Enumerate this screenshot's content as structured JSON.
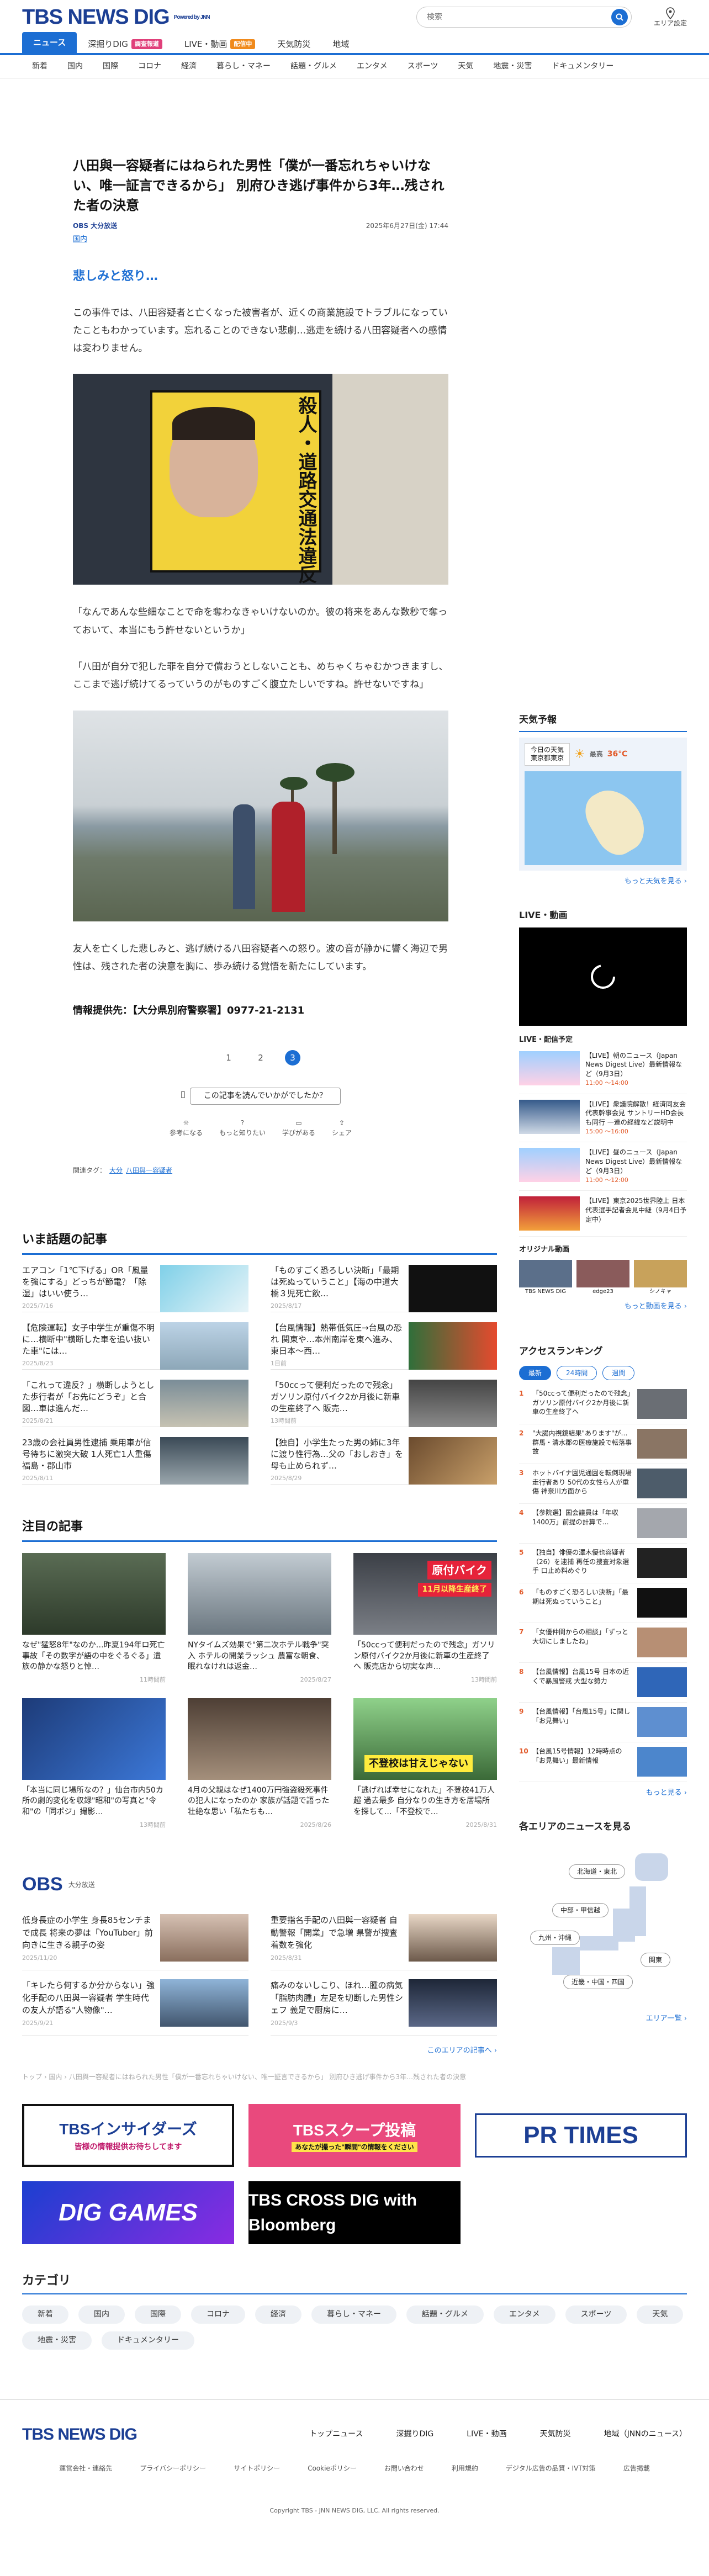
{
  "header": {
    "logo_text": "TBS NEWS DIG",
    "powered": "Powered by JNN",
    "search_placeholder": "検索",
    "area_label": "エリア設定"
  },
  "nav_primary": [
    {
      "label": "ニュース",
      "active": true
    },
    {
      "label": "深掘りDIG",
      "badge": "調査報道"
    },
    {
      "label": "LIVE・動画",
      "badge": "配信中"
    },
    {
      "label": "天気防災"
    },
    {
      "label": "地域"
    }
  ],
  "nav_secondary": [
    "新着",
    "国内",
    "国際",
    "コロナ",
    "経済",
    "暮らし・マネー",
    "話題・グルメ",
    "エンタメ",
    "スポーツ",
    "天気",
    "地震・災害",
    "ドキュメンタリー"
  ],
  "article": {
    "title": "八田與一容疑者にはねられた男性「僕が一番忘れちゃいけない、唯一証言できるから」 別府ひき逃げ事件から3年…残された者の決意",
    "source": "OBS 大分放送",
    "category": "国内",
    "date": "2025年6月27日(金) 17:44",
    "subheading": "悲しみと怒り…",
    "para1": "この事件では、八田容疑者と亡くなった被害者が、近くの商業施設でトラブルになっていたこともわかっています。忘れることのできない悲劇…逃走を続ける八田容疑者への感情は変わりません。",
    "para2": "「なんであんな些細なことで命を奪わなきゃいけないのか。彼の将来をあんな数秒で奪っておいて、本当にもう許せないというか」",
    "para3": "「八田が自分で犯した罪を自分で償おうとしないことも、めちゃくちゃむかつきますし、ここまで逃げ続けてるっていうのがものすごく腹立たしいですね。許せないですね」",
    "para4": "友人を亡くした悲しみと、逃げ続ける八田容疑者への怒り。波の音が静かに響く海辺で男性は、残された者の決意を胸に、歩み続ける覚悟を新たにしています。",
    "poster_text": "殺人・道路交通法違反",
    "credit": "情報提供先：【大分県別府警察署】0977-21-2131",
    "pages": [
      "1",
      "2",
      "3"
    ],
    "feedback_q": "この記事を読んでいかがでしたか？",
    "reactions": [
      "参考になる",
      "もっと知りたい",
      "学びがある",
      "シェア"
    ],
    "tags_label": "関連タグ：",
    "tags": [
      "大分",
      "八田與一容疑者"
    ]
  },
  "hot": {
    "title": "いま話題の記事",
    "items": [
      {
        "text": "エアコン「1℃下げる」OR「風量を強にする」どっちが節電？「除湿」はいい使う…",
        "date": "2025/7/16"
      },
      {
        "text": "「ものすごく恐ろしい決断」「最期は死ぬっていうこと」【海の中道大橋３児死亡飲…",
        "date": "2025/8/17"
      },
      {
        "text": "【危険運転】女子中学生が重傷不明に…横断中\"横断した車を追い抜いた車\"には…",
        "date": "2025/8/23"
      },
      {
        "text": "【台風情報】熱帯低気圧→台風の恐れ 関東や…本州南岸を東へ進み、東日本〜西…",
        "date": "1日前"
      },
      {
        "text": "「これって違反？」横断しようとした歩行者が「お先にどうぞ」と合図…車は進んだ…",
        "date": "2025/8/21"
      },
      {
        "text": "「50ccって便利だったので残念」ガソリン原付バイク2か月後に新車の生産終了へ 販売…",
        "date": "13時間前"
      },
      {
        "text": "23歳の会社員男性逮捕 乗用車が信号待ちに激突大破 1人死亡1人重傷 福島・郡山市",
        "date": "2025/8/11"
      },
      {
        "text": "【独自】小学生たった男の姉に3年に渡り性行為…父の「おしおき」を母も止められず…",
        "date": "2025/8/29"
      }
    ]
  },
  "featured": {
    "title": "注目の記事",
    "items": [
      {
        "text": "なぜ\"猛怒8年\"なのか…昨夏194年ロ死亡事故「その数字が語の中をぐるぐる」遺族の静かな怒りと悼…",
        "date": "11時間前"
      },
      {
        "text": "NYタイムズ効果で\"第二次ホテル戦争\"突入 ホテルの開業ラッシュ 農富な朝食、眠れなけれは返金…",
        "date": "2025/8/27"
      },
      {
        "text": "「50ccって便利だったので残念」ガソリン原付バイク2か月後に新車の生産終了へ 販売店から切実な声…",
        "date": "13時間前"
      },
      {
        "text": "「本当に同じ場所なの？」仙台市内50カ所の劇的変化を収録\"昭和\"の写真と\"令和\"の「同ポジ」撮影…",
        "date": "13時間前"
      },
      {
        "text": "4月の父親はなぜ1400万円強盗殺死事件の犯人になったのか 家族が話題で語った壮絶な思い「私たちも…",
        "date": "2025/8/26"
      },
      {
        "text": "「逃げれば幸せになれた」不登校41万人超 過去最多 自分なりの生き方を居場所を探して…「不登校で…",
        "date": "2025/8/31"
      }
    ],
    "ribbon_1": "原付バイク",
    "ribbon_2": "11月以降生産終了",
    "ribbon_3": "不登校は甘えじゃない"
  },
  "obs": {
    "logo": "OBS",
    "name": "大分放送",
    "items": [
      {
        "text": "低身長症の小学生 身長85センチまで成長 将来の夢は「YouTuber」前向きに生きる親子の姿",
        "date": "2025/11/20"
      },
      {
        "text": "重要指名手配の八田與一容疑者 自動警報「開業」で急増 県警が捜査着数を強化",
        "date": "2025/8/31"
      },
      {
        "text": "「キレたら何するか分からない」強化手配の八田與一容疑者 学生時代の友人が語る\"人物像\"…",
        "date": "2025/9/21"
      },
      {
        "text": "痛みのないしこり、ほれ…腫の病気「脂肪肉腫」左足を切断した男性シェフ 義足で厨房に…",
        "date": "2025/9/3"
      }
    ],
    "more": "このエリアの記事へ ›"
  },
  "breadcrumb": "トップ › 国内 › 八田與一容疑者にはねられた男性「僕が一番忘れちゃいけない、唯一証言できるから」 別府ひき逃げ事件から3年…残された者の決意",
  "banners": [
    {
      "text": "TBSインサイダーズ",
      "sub": "皆様の情報提供お待ちしてます"
    },
    {
      "text": "TBSスクープ投稿",
      "sub": "あなたが撮った\"瞬間\"の情報をください"
    },
    {
      "text": "PR TIMES",
      "sub": ""
    },
    {
      "text": "DIG GAMES",
      "sub": ""
    },
    {
      "text": "TBS CROSS DIG with Bloomberg",
      "sub": ""
    }
  ],
  "categories": {
    "title": "カテゴリ",
    "items": [
      "新着",
      "国内",
      "国際",
      "コロナ",
      "経済",
      "暮らし・マネー",
      "話題・グルメ",
      "エンタメ",
      "スポーツ",
      "天気",
      "地震・災害",
      "ドキュメンタリー"
    ]
  },
  "footer": {
    "logo": "TBS NEWS DIG",
    "links": [
      "トップニュース",
      "深掘りDIG",
      "LIVE・動画",
      "天気防災",
      "地域（JNNのニュース）"
    ],
    "links2": [
      "運営会社・連絡先",
      "プライバシーポリシー",
      "サイトポリシー",
      "Cookieポリシー",
      "お問い合わせ",
      "利用規約",
      "デジタル広告の品質・IVT対策",
      "広告掲載"
    ],
    "copyright": "Copyright TBS - JNN NEWS DIG, LLC. All rights reserved."
  },
  "side": {
    "weather_title": "天気予報",
    "weather_tabs": [
      "今日の天気",
      "東京都東京"
    ],
    "weather_high": "最高",
    "weather_temp": "36℃",
    "weather_link": "もっと天気を見る ›",
    "live_title": "LIVE・動画",
    "sched_title": "LIVE・配信予定",
    "sched": [
      {
        "tag": "配信中",
        "text": "【LIVE】朝のニュース（Japan News Digest Live）最新情報など（9月3日）",
        "time": "11:00 〜14:00"
      },
      {
        "text": "【LIVE】衆議院解散！経済同友会代表幹事会見 サントリーHD会長も同行 一連の経緯など説明中",
        "time": "15:00 〜16:00"
      },
      {
        "text": "【LIVE】昼のニュース（Japan News Digest Live）最新情報など（9月3日）",
        "time": "11:00 〜12:00"
      },
      {
        "tag": "予定",
        "text": "【LIVE】東京2025世界陸上 日本代表選手記者会見中継（9月4日予定中）",
        "time": ""
      }
    ],
    "original_title": "オリジナル動画",
    "original": [
      "TBS NEWS DIG",
      "edge23",
      "シノキャ"
    ],
    "original_link": "もっと動画を見る ›",
    "rank_title": "アクセスランキング",
    "rank_tabs": [
      "最新",
      "24時間",
      "週間"
    ],
    "rank": [
      "「50ccって便利だったので残念」ガソリン原付バイク2か月後に新車の生産終了へ",
      "\"大腸内視鏡結果\"あります\"が…群馬・清水郡の医療施設で転落事故",
      "ホットバイナ園児通園を転倒現場走行者あり 50代の女性ら人が重傷 神奈川方面から",
      "【参院選】国会議員は「年収1400万」前提の計算で…",
      "【独自】俳優の澤木優也容疑者（26）を逮捕 再任の捜査対象選手 口止め料めぐり",
      "「ものすごく恐ろしい決断」「最期は死ぬっていうこと」",
      "「女優仲間からの相談」「ずっと大切にしましたね」",
      "【台風情報】台風15号 日本の近くで暴風警戒 大型な勢力",
      "【台風情報】「台風15号」に関し「お見舞い」",
      "【台風15号情報】12時時点の「お見舞い」最新情報"
    ],
    "rank_link": "もっと見る ›",
    "area_title": "各エリアのニュースを見る",
    "areas": [
      "北海道・東北",
      "中部・甲信越",
      "九州・沖縄",
      "関東",
      "近畿・中国・四国"
    ],
    "area_link": "エリア一覧 ›"
  }
}
